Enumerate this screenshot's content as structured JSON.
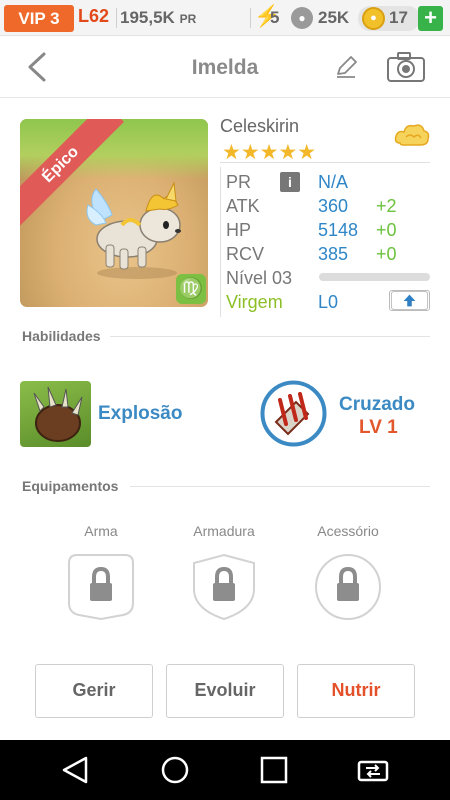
{
  "status": {
    "vip": "VIP 3",
    "level": "L62",
    "power_value": "195,5K",
    "power_unit": "PR",
    "energy": "5",
    "paws": "25K",
    "coins": "17",
    "add": "+"
  },
  "header": {
    "title": "Imelda"
  },
  "pet": {
    "rarity": "Épico",
    "name": "Celeskirin",
    "stars": "★★★★★",
    "zodiac_glyph": "♍",
    "stats": [
      {
        "label": "PR",
        "value": "N/A",
        "bonus": ""
      },
      {
        "label": "ATK",
        "value": "360",
        "bonus": "+2"
      },
      {
        "label": "HP",
        "value": "5148",
        "bonus": "+0"
      },
      {
        "label": "RCV",
        "value": "385",
        "bonus": "+0"
      }
    ],
    "info": "i",
    "level_label": "Nível 03",
    "xp_fraction": 0,
    "sign": "Virgem",
    "sign_level": "L0"
  },
  "skills": {
    "title": "Habilidades",
    "items": [
      {
        "name": "Explosão",
        "level": ""
      },
      {
        "name": "Cruzado",
        "level": "LV 1"
      }
    ]
  },
  "equipment": {
    "title": "Equipamentos",
    "slots": [
      {
        "label": "Arma"
      },
      {
        "label": "Armadura"
      },
      {
        "label": "Acessório"
      }
    ]
  },
  "actions": {
    "manage": "Gerir",
    "evolve": "Evoluir",
    "feed": "Nutrir"
  },
  "colors": {
    "accent": "#ef6a2a",
    "link": "#2f86c7",
    "bonus": "#6cc23c",
    "rarity": "#e05b57"
  }
}
